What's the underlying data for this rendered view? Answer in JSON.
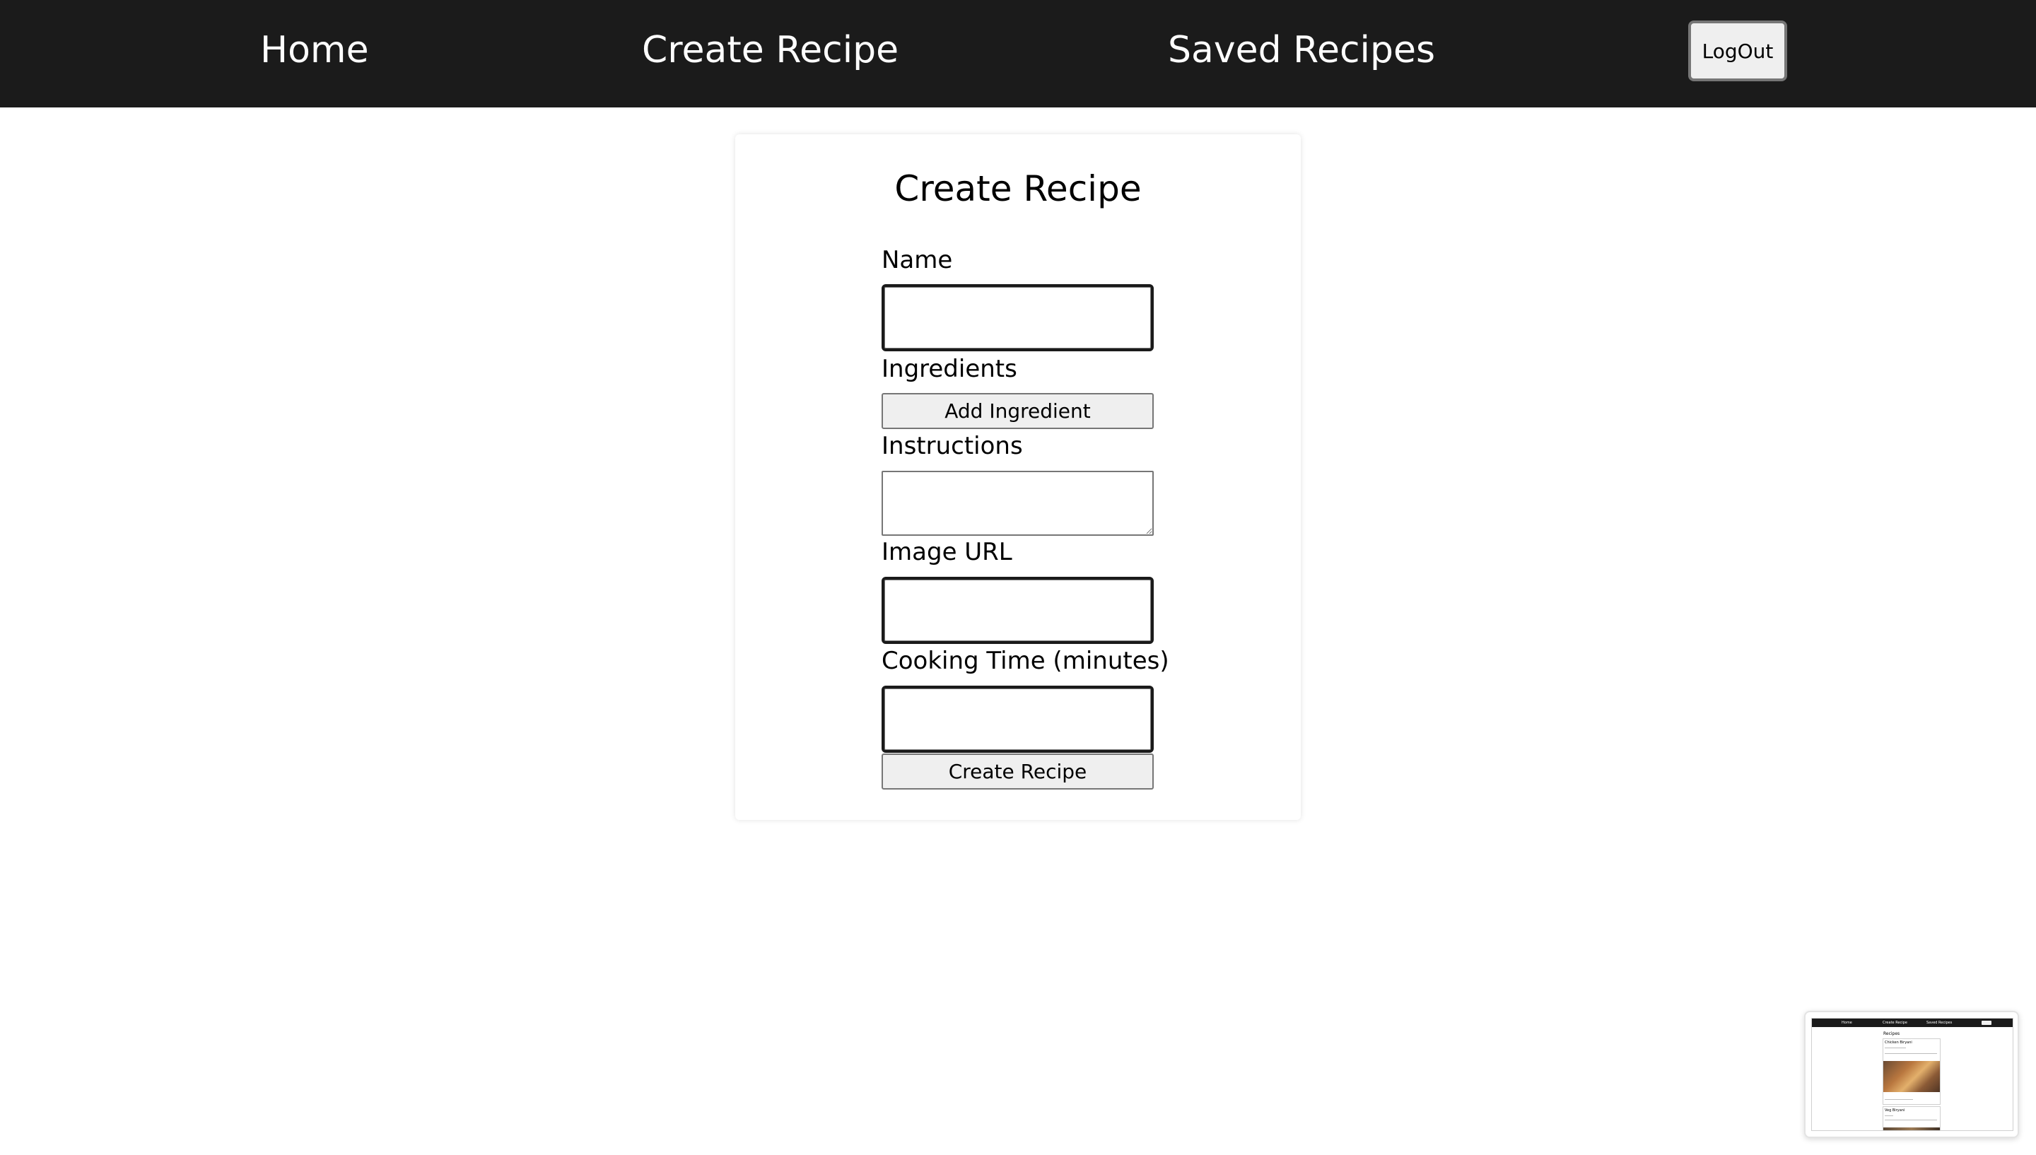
{
  "navbar": {
    "home_label": "Home",
    "create_recipe_label": "Create Recipe",
    "saved_recipes_label": "Saved Recipes",
    "logout_label": "LogOut",
    "background_color": "#1b1b1b"
  },
  "form": {
    "title": "Create Recipe",
    "name_label": "Name",
    "name_value": "",
    "ingredients_label": "Ingredients",
    "add_ingredient_label": "Add Ingredient",
    "instructions_label": "Instructions",
    "instructions_value": "",
    "image_url_label": "Image URL",
    "image_url_value": "",
    "cooking_time_label": "Cooking Time (minutes)",
    "cooking_time_value": "",
    "submit_label": "Create Recipe"
  },
  "preview_thumbnail": {
    "nav_home": "Home",
    "nav_create": "Create Recipe",
    "nav_saved": "Saved Recipes",
    "page_title": "Recipes",
    "card_1_title": "Chicken Biryani",
    "card_2_title": "Veg Biryani"
  }
}
